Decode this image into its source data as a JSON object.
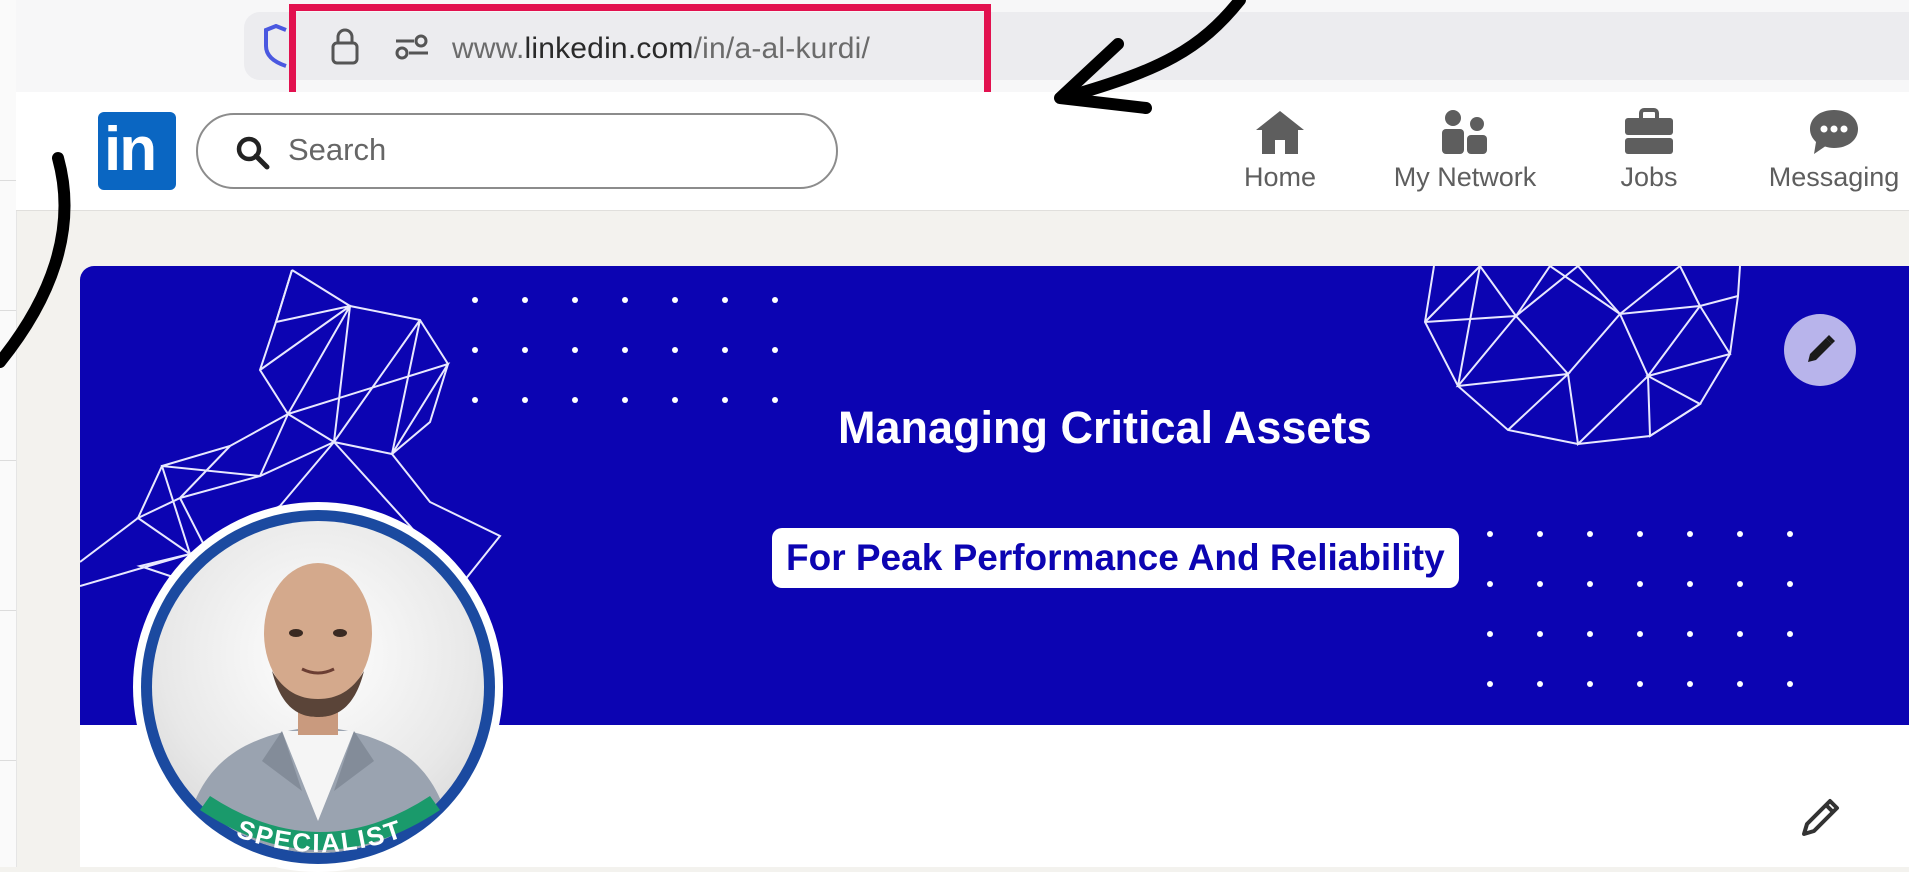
{
  "browser": {
    "url_prefix": "www.",
    "url_domain": "linkedin.com",
    "url_path": "/in/a-al-kurdi/"
  },
  "linkedin": {
    "logo_text": "in",
    "search": {
      "placeholder": "Search"
    },
    "nav_items": [
      {
        "label": "Home",
        "icon": "home-icon"
      },
      {
        "label": "My Network",
        "icon": "network-icon"
      },
      {
        "label": "Jobs",
        "icon": "briefcase-icon"
      },
      {
        "label": "Messaging",
        "icon": "messaging-icon"
      }
    ]
  },
  "profile": {
    "banner_title": "Managing Critical Assets",
    "banner_subtitle": "For Peak Performance And Reliability",
    "avatar_badge": "SPECIALIST"
  },
  "colors": {
    "linkedin_blue": "#0a66c2",
    "banner_bg": "#0c04b2",
    "highlight_red": "#e2114f",
    "badge_green": "#1a9a6b"
  }
}
